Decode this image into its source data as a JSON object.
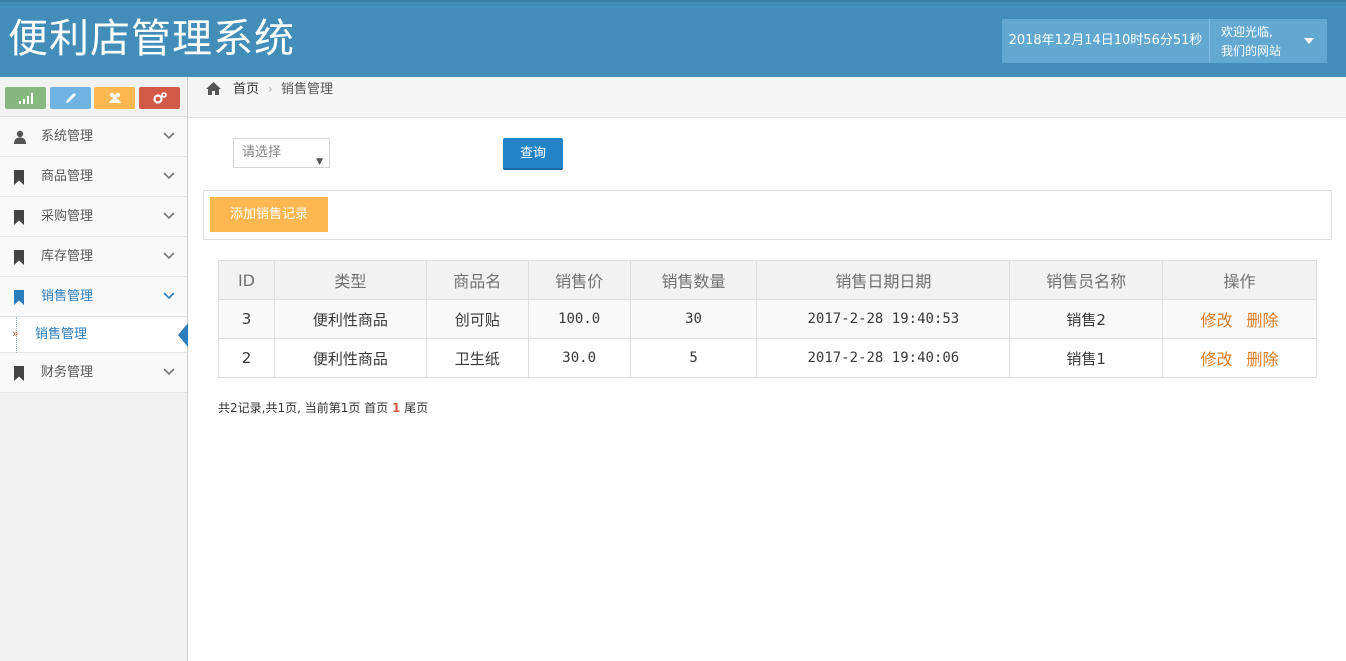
{
  "header": {
    "title": "便利店管理系统",
    "datetime": "2018年12月14日10时56分51秒",
    "welcome_line1": "欢迎光临,",
    "welcome_line2": "我们的网站"
  },
  "sidebar": {
    "shortcut_colors": [
      "#87b87f",
      "#6fb3e0",
      "#ffb752",
      "#d15b47"
    ],
    "items": [
      {
        "label": "系统管理",
        "icon": "user-icon"
      },
      {
        "label": "商品管理",
        "icon": "bookmark-icon"
      },
      {
        "label": "采购管理",
        "icon": "bookmark-icon"
      },
      {
        "label": "库存管理",
        "icon": "bookmark-icon"
      },
      {
        "label": "销售管理",
        "icon": "bookmark-icon"
      },
      {
        "label": "财务管理",
        "icon": "bookmark-icon"
      }
    ],
    "subitem": {
      "label": "销售管理"
    }
  },
  "breadcrumb": {
    "home": "首页",
    "current": "销售管理"
  },
  "filter": {
    "select_placeholder": "请选择",
    "query_label": "查询"
  },
  "toolbar": {
    "add_label": "添加销售记录"
  },
  "table": {
    "headers": [
      "ID",
      "类型",
      "商品名",
      "销售价",
      "销售数量",
      "销售日期日期",
      "销售员名称",
      "操作"
    ],
    "rows": [
      {
        "id": "3",
        "type": "便利性商品",
        "name": "创可贴",
        "price": "100.0",
        "qty": "30",
        "date": "2017-2-28 19:40:53",
        "seller": "销售2",
        "edit": "修改",
        "del": "删除"
      },
      {
        "id": "2",
        "type": "便利性商品",
        "name": "卫生纸",
        "price": "30.0",
        "qty": "5",
        "date": "2017-2-28 19:40:06",
        "seller": "销售1",
        "edit": "修改",
        "del": "删除"
      }
    ]
  },
  "pager": {
    "summary": "共2记录,共1页, 当前第1页",
    "first": "首页",
    "current": "1",
    "last": "尾页"
  }
}
